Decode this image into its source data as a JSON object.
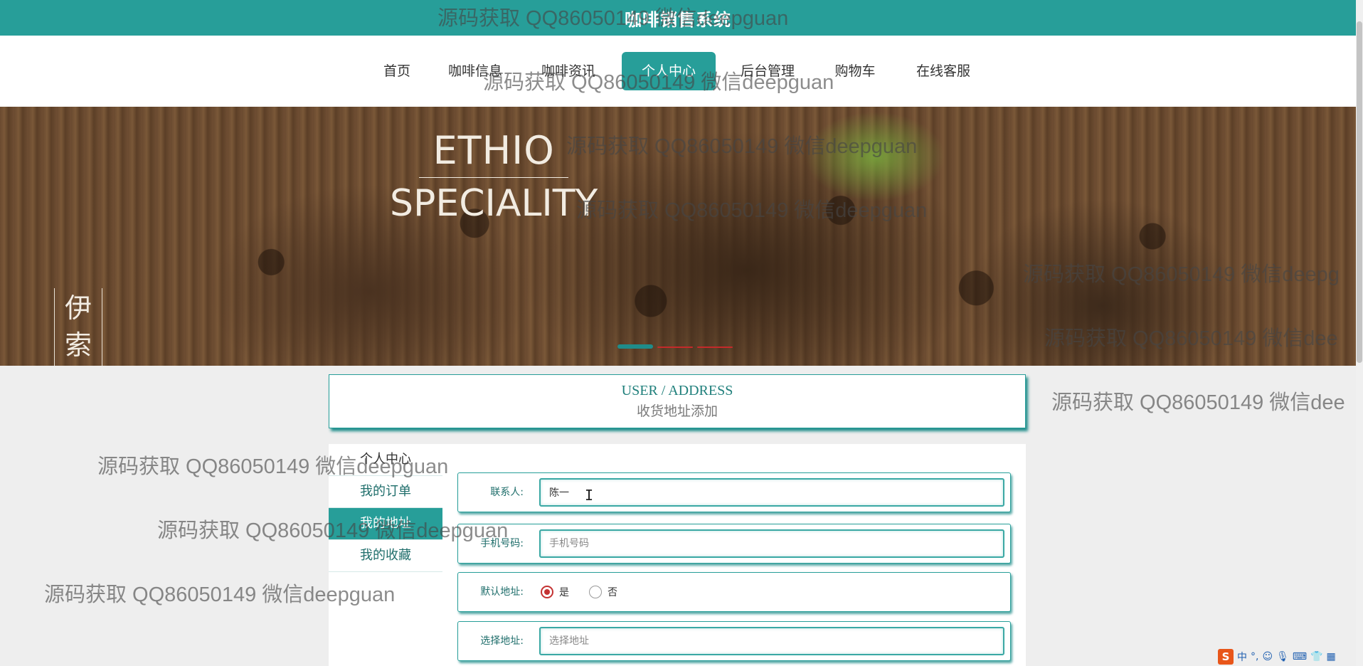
{
  "header": {
    "title": "咖啡销售系统"
  },
  "nav": {
    "items": [
      {
        "label": "首页"
      },
      {
        "label": "咖啡信息"
      },
      {
        "label": "咖啡资讯"
      },
      {
        "label": "个人中心"
      },
      {
        "label": "后台管理"
      },
      {
        "label": "购物车"
      },
      {
        "label": "在线客服"
      }
    ],
    "active": "个人中心"
  },
  "banner": {
    "brand_en_line1": "ETHIO",
    "brand_en_line2": "SPECIALITY",
    "brand_cn": "伊索",
    "slides_total": 3,
    "slide_active": 1
  },
  "section": {
    "en_title": "USER / ADDRESS",
    "cn_title": "收货地址添加"
  },
  "sidebar": {
    "items": [
      {
        "label": "个人中心"
      },
      {
        "label": "我的订单"
      },
      {
        "label": "我的地址"
      },
      {
        "label": "我的收藏"
      }
    ],
    "active": "我的地址"
  },
  "form": {
    "contact_label": "联系人:",
    "contact_value": "陈一",
    "phone_label": "手机号码:",
    "phone_placeholder": "手机号码",
    "default_label": "默认地址:",
    "default_options": [
      "是",
      "否"
    ],
    "default_selected": "是",
    "address_label": "选择地址:",
    "address_placeholder": "选择地址"
  },
  "watermarks": {
    "text": "源码获取 QQ86050149 微信deepguan",
    "text_cut_1": "源码获取 QQ86050149 微信dee",
    "text_cut_2": "源码获取 QQ86050149 微信deepg",
    "text_cut_3": "源码获取 QQ86050149 微信dee"
  },
  "tray": {
    "ime_label": "中",
    "ime_logo": "S"
  },
  "colors": {
    "brand": "#279e99",
    "brand_dark": "#1f8c8a",
    "radio_checked": "#c43232"
  }
}
